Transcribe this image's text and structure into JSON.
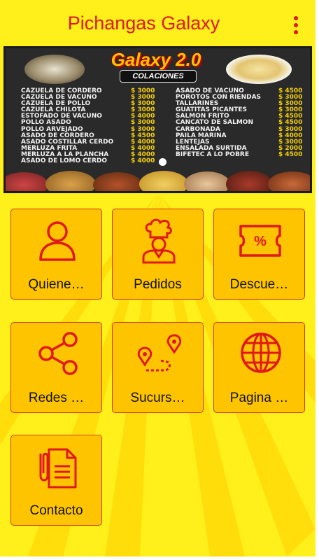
{
  "app": {
    "title": "Pichangas Galaxy"
  },
  "colors": {
    "primary": "#e01818",
    "background": "#ffef1a",
    "tile": "#ffc400",
    "price": "#f5d000"
  },
  "banner": {
    "logo_text": "Galaxy 2.0",
    "subtitle": "COLACIONES",
    "left_items": [
      {
        "name": "CAZUELA DE CORDERO",
        "price": "$ 3000"
      },
      {
        "name": "CAZUELA DE VACUNO",
        "price": "$ 3000"
      },
      {
        "name": "CAZUELA DE POLLO",
        "price": "$ 3000"
      },
      {
        "name": "CAZUELA CHILOTA",
        "price": "$ 3000"
      },
      {
        "name": "ESTOFADO DE VACUNO",
        "price": "$ 4000"
      },
      {
        "name": "POLLO ASADO",
        "price": "$ 3000"
      },
      {
        "name": "POLLO ARVEJADO",
        "price": "$ 3000"
      },
      {
        "name": "ASADO DE CORDERO",
        "price": "$ 4500"
      },
      {
        "name": "ASADO COSTILLAR CERDO",
        "price": "$ 4000"
      },
      {
        "name": "MERLUZA FRITA",
        "price": "$ 4000"
      },
      {
        "name": "MERLUZA A LA PLANCHA",
        "price": "$ 4000"
      },
      {
        "name": "ASADO DE LOMO CERDO",
        "price": "$ 4000"
      }
    ],
    "right_items": [
      {
        "name": "ASADO DE VACUNO",
        "price": "$ 4500"
      },
      {
        "name": "POROTOS CON RIENDAS",
        "price": "$ 3000"
      },
      {
        "name": "TALLARINES",
        "price": "$ 3000"
      },
      {
        "name": "GUATITAS PICANTES",
        "price": "$ 3000"
      },
      {
        "name": "SALMON FRITO",
        "price": "$ 4500"
      },
      {
        "name": "CANCATO DE SALMON",
        "price": "$ 4500"
      },
      {
        "name": "CARBONADA",
        "price": "$ 3000"
      },
      {
        "name": "PAILA MARINA",
        "price": "$ 4000"
      },
      {
        "name": "LENTEJAS",
        "price": "$ 3000"
      },
      {
        "name": "ENSALADA SURTIDA",
        "price": "$ 2000"
      },
      {
        "name": "BIFETEC A LO POBRE",
        "price": "$ 4500"
      }
    ]
  },
  "tiles": [
    {
      "label": "Quiene…",
      "icon": "person-icon"
    },
    {
      "label": "Pedidos",
      "icon": "chef-icon"
    },
    {
      "label": "Descue…",
      "icon": "discount-ticket-icon"
    },
    {
      "label": "Redes …",
      "icon": "share-icon"
    },
    {
      "label": "Sucurs…",
      "icon": "route-map-icon"
    },
    {
      "label": "Pagina …",
      "icon": "globe-icon"
    },
    {
      "label": "Contacto",
      "icon": "document-clip-icon"
    }
  ]
}
